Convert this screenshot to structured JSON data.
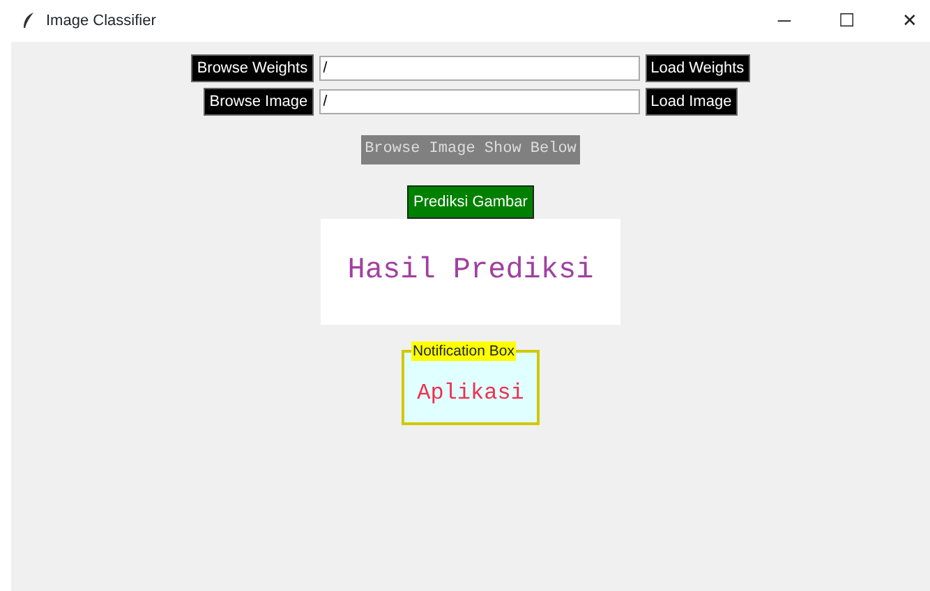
{
  "window": {
    "title": "Image Classifier",
    "controls": [
      "─",
      "☐",
      "✕"
    ]
  },
  "rows": [
    {
      "browse_button": "Browse Weights",
      "path": "/",
      "load_button": "Load Weights"
    },
    {
      "browse_button": "Browse Image",
      "path": "/",
      "load_button": "Load Image"
    }
  ],
  "image_label": "Browse Image Show Below",
  "predict_button": "Prediksi Gambar",
  "result": "Hasil Prediksi",
  "notification": {
    "title": "Notification Box",
    "text": "Aplikasi"
  }
}
